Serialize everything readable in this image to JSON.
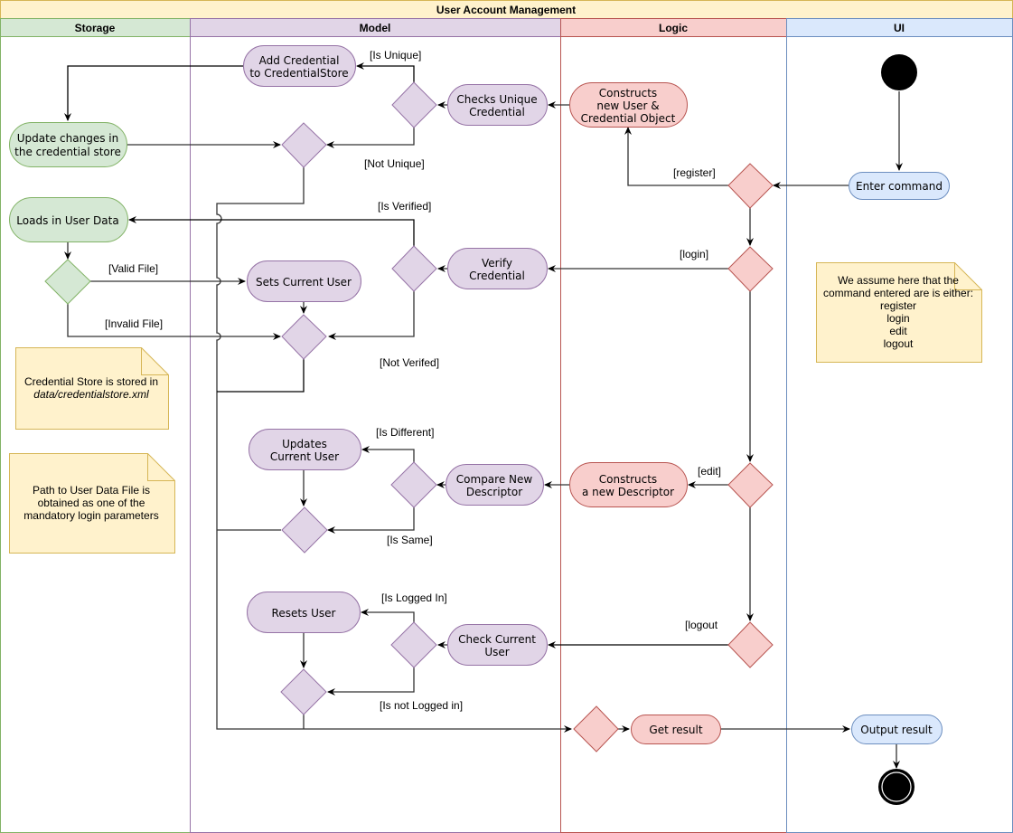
{
  "diagram": {
    "title": "User Account Management",
    "lanes": [
      {
        "id": "storage",
        "label": "Storage",
        "fill": "#d5e8d4",
        "stroke": "#82b366"
      },
      {
        "id": "model",
        "label": "Model",
        "fill": "#e1d5e7",
        "stroke": "#9673a6"
      },
      {
        "id": "logic",
        "label": "Logic",
        "fill": "#f8cecc",
        "stroke": "#b85450"
      },
      {
        "id": "ui",
        "label": "UI",
        "fill": "#dae8fc",
        "stroke": "#6c8ebf"
      }
    ],
    "title_fill": "#fff2cc",
    "title_stroke": "#d6b656",
    "nodes": {
      "add_credential": [
        "Add Credential",
        "to CredentialStore"
      ],
      "checks_unique": [
        "Checks Unique",
        "Credential"
      ],
      "constructs_user": [
        "Constructs",
        "new User &",
        "Credential Object"
      ],
      "update_changes": [
        "Update changes in",
        "the credential store"
      ],
      "enter_command": [
        "Enter command"
      ],
      "loads_user_data": [
        "Loads in User Data"
      ],
      "sets_current_user": [
        "Sets Current User"
      ],
      "verify_credential": [
        "Verify",
        "Credential"
      ],
      "updates_current_user": [
        "Updates",
        "Current User"
      ],
      "compare_descriptor": [
        "Compare New",
        "Descriptor"
      ],
      "constructs_descriptor": [
        "Constructs",
        "a new Descriptor"
      ],
      "resets_user": [
        "Resets User"
      ],
      "check_current_user": [
        "Check Current",
        "User"
      ],
      "get_result": [
        "Get result"
      ],
      "output_result": [
        "Output result"
      ]
    },
    "guards": {
      "is_unique": "[Is Unique]",
      "not_unique": "[Not Unique]",
      "register": "[register]",
      "is_verified": "[Is Verified]",
      "valid_file": "[Valid File]",
      "invalid_file": "[Invalid File]",
      "login": "[login]",
      "not_verified": "[Not Verifed]",
      "is_different": "[Is Different]",
      "is_same": "[Is Same]",
      "edit": "[edit]",
      "is_logged_in": "[Is Logged In]",
      "logout": "[logout",
      "is_not_logged_in": "[Is not Logged in]"
    },
    "notes": {
      "credential_store": [
        "Credential Store is stored in",
        "data/credentialstore.xml"
      ],
      "user_data_path": [
        "Path to User Data File is",
        "obtained as one of the",
        "mandatory login parameters"
      ],
      "assumption": [
        "We assume here that the",
        "command entered are is either:",
        "register",
        "login",
        "edit",
        "logout"
      ]
    }
  }
}
